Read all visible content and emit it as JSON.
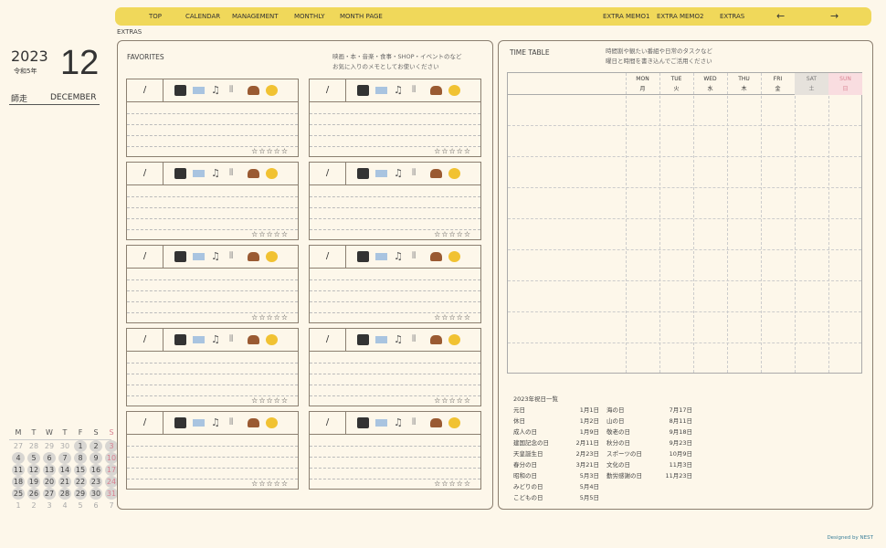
{
  "nav": {
    "items": [
      "TOP",
      "CALENDAR",
      "MANAGEMENT",
      "MONTHLY",
      "MONTH PAGE",
      "EXTRA MEMO1",
      "EXTRA MEMO2",
      "EXTRAS",
      "←",
      "→"
    ]
  },
  "breadcrumb": "EXTRAS",
  "date": {
    "year": "2023",
    "era": "令和5年",
    "month": "12",
    "jp_month": "師走",
    "en_month": "DECEMBER"
  },
  "mini_calendar": {
    "weekdays": [
      "M",
      "T",
      "W",
      "T",
      "F",
      "S",
      "S"
    ],
    "weeks": [
      [
        "27",
        "28",
        "29",
        "30",
        "1",
        "2",
        "3"
      ],
      [
        "4",
        "5",
        "6",
        "7",
        "8",
        "9",
        "10"
      ],
      [
        "11",
        "12",
        "13",
        "14",
        "15",
        "16",
        "17"
      ],
      [
        "18",
        "19",
        "20",
        "21",
        "22",
        "23",
        "24"
      ],
      [
        "25",
        "26",
        "27",
        "28",
        "29",
        "30",
        "31"
      ],
      [
        "1",
        "2",
        "3",
        "4",
        "5",
        "6",
        "7"
      ]
    ]
  },
  "favorites": {
    "title": "FAVORITES",
    "note1": "映画・本・音楽・食事・SHOP・イベントのなど",
    "note2": "お気に入りのメモとしてお使いください",
    "cards": [
      {
        "date": "/",
        "stars": "☆☆☆☆☆"
      },
      {
        "date": "/",
        "stars": "☆☆☆☆☆"
      },
      {
        "date": "/",
        "stars": "☆☆☆☆☆"
      },
      {
        "date": "/",
        "stars": "☆☆☆☆☆"
      },
      {
        "date": "/",
        "stars": "☆☆☆☆☆"
      },
      {
        "date": "/",
        "stars": "☆☆☆☆☆"
      },
      {
        "date": "/",
        "stars": "☆☆☆☆☆"
      },
      {
        "date": "/",
        "stars": "☆☆☆☆☆"
      },
      {
        "date": "/",
        "stars": "☆☆☆☆☆"
      },
      {
        "date": "/",
        "stars": "☆☆☆☆☆"
      }
    ],
    "icons": [
      "movie-camera-icon",
      "book-icon",
      "music-notes-icon",
      "fork-knife-icon",
      "handbag-icon",
      "clapping-hands-icon"
    ]
  },
  "timetable": {
    "title": "TIME TABLE",
    "note1": "時間割や観たい番組や日常のタスクなど",
    "note2": "曜日と時間を書き込んでご活用ください",
    "days": [
      {
        "en": "MON",
        "jp": "月"
      },
      {
        "en": "TUE",
        "jp": "火"
      },
      {
        "en": "WED",
        "jp": "水"
      },
      {
        "en": "THU",
        "jp": "木"
      },
      {
        "en": "FRI",
        "jp": "金"
      },
      {
        "en": "SAT",
        "jp": "土"
      },
      {
        "en": "SUN",
        "jp": "日"
      }
    ]
  },
  "holidays": {
    "title": "2023年祝日一覧",
    "items": [
      [
        "元日",
        "1月1日"
      ],
      [
        "休日",
        "1月2日"
      ],
      [
        "成人の日",
        "1月9日"
      ],
      [
        "建国記念の日",
        "2月11日"
      ],
      [
        "天皇誕生日",
        "2月23日"
      ],
      [
        "春分の日",
        "3月21日"
      ],
      [
        "昭和の日",
        "5月3日"
      ],
      [
        "みどりの日",
        "5月4日"
      ],
      [
        "こどもの日",
        "5月5日"
      ],
      [
        "海の日",
        "7月17日"
      ],
      [
        "山の日",
        "8月11日"
      ],
      [
        "敬老の日",
        "9月18日"
      ],
      [
        "秋分の日",
        "9月23日"
      ],
      [
        "スポーツの日",
        "10月9日"
      ],
      [
        "文化の日",
        "11月3日"
      ],
      [
        "勤労感謝の日",
        "11月23日"
      ]
    ]
  },
  "footer": "Designed by NEST",
  "colors": {
    "nav": "#f0d85a",
    "sun": "#d98090",
    "sat_bg": "#e6e2dc",
    "sun_bg": "#f9dde0"
  }
}
